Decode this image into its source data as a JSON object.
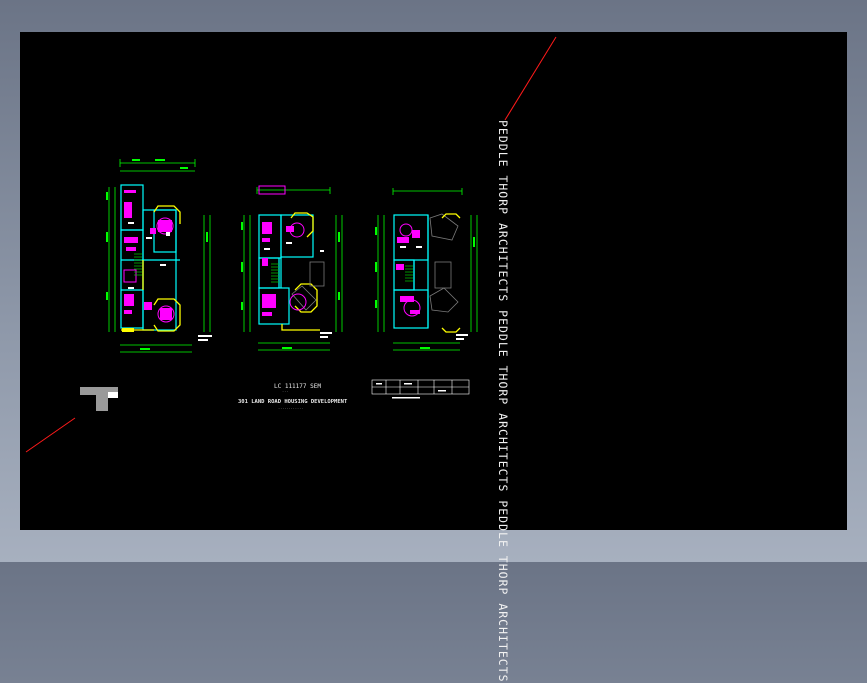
{
  "viewer": {
    "background_color": "#000000",
    "frame_color": "#8f99aa"
  },
  "drawing": {
    "watermark_text": "PEDDLE THORP ARCHITECTS PEDDLE THORP ARCHITECTS PEDDLE THORP ARCHITECTS",
    "title_line_1": "LC 111177   SEM",
    "title_line_2": "...",
    "title_line_3": "301 LAND ROAD HOUSING DEVELOPMENT",
    "title_line_4": "............",
    "colors": {
      "wall_cyan": "#00ffff",
      "furniture_magenta": "#ff00ff",
      "dimension_green": "#00ff00",
      "bay_yellow": "#ffff00",
      "stair_green": "#00d000",
      "leader_red": "#ff1a1a",
      "text_white": "#ffffff"
    }
  }
}
